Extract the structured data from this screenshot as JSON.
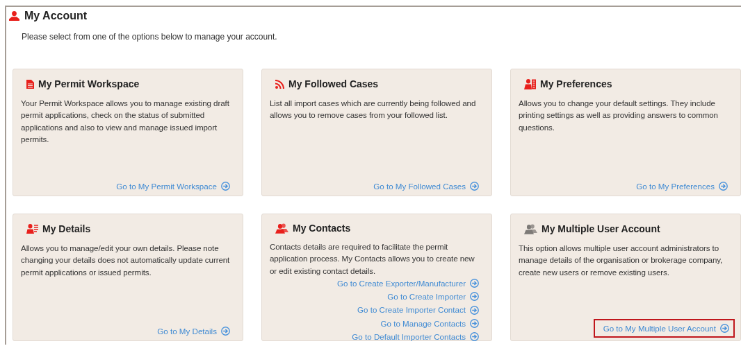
{
  "page": {
    "title": "My Account",
    "intro": "Please select from one of the options below to manage your account."
  },
  "cards": [
    {
      "kind": "document",
      "title": "My Permit Workspace",
      "description": "Your Permit Workspace allows you to manage existing draft permit applications, check on the status of submitted applications and also to view and manage issued import permits.",
      "links": [
        {
          "label": "Go to My Permit Workspace",
          "highlighted": false
        }
      ]
    },
    {
      "kind": "feed",
      "title": "My Followed Cases",
      "description": "List all import cases which are currently being followed and allows you to remove cases from your followed list.",
      "links": [
        {
          "label": "Go to My Followed Cases",
          "highlighted": false
        }
      ]
    },
    {
      "kind": "person-settings",
      "title": "My Preferences",
      "description": "Allows you to change your default settings. They include printing settings as well as providing answers to common questions.",
      "links": [
        {
          "label": "Go to My Preferences",
          "highlighted": false
        }
      ]
    },
    {
      "kind": "person-card",
      "title": "My Details",
      "description": "Allows you to manage/edit your own details. Please note changing your details does not automatically update current permit applications or issued permits.",
      "links": [
        {
          "label": "Go to My Details",
          "highlighted": false
        }
      ]
    },
    {
      "kind": "people",
      "title": "My Contacts",
      "description": "Contacts details are required to facilitate the permit application process. My Contacts allows you to create new or edit existing contact details.",
      "links": [
        {
          "label": "Go to Create Exporter/Manufacturer",
          "highlighted": false
        },
        {
          "label": "Go to Create Importer",
          "highlighted": false
        },
        {
          "label": "Go to Create Importer Contact",
          "highlighted": false
        },
        {
          "label": "Go to Manage Contacts",
          "highlighted": false
        },
        {
          "label": "Go to Default Importer Contacts",
          "highlighted": false
        }
      ]
    },
    {
      "kind": "people-grey",
      "title": "My Multiple User Account",
      "description": "This option allows multiple user account administrators to manage details of the organisation or brokerage company, create new users or remove existing users.",
      "links": [
        {
          "label": "Go to My Multiple User Account",
          "highlighted": true
        }
      ]
    }
  ]
}
